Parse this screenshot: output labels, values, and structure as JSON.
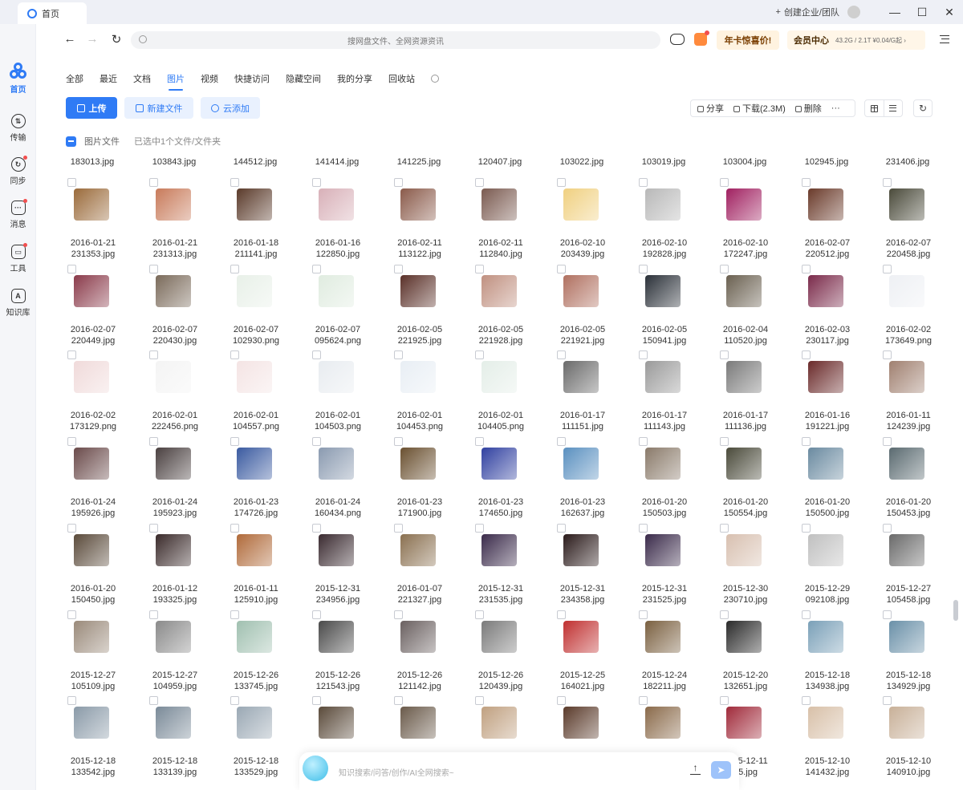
{
  "window": {
    "tab_title": "首页",
    "create_team": "创建企业/团队",
    "controls": [
      "—",
      "☐",
      "✕"
    ]
  },
  "rail": {
    "items": [
      {
        "label": "首页",
        "icon": "home-logo-icon",
        "active": true
      },
      {
        "label": "传输",
        "icon": "transfer-icon",
        "badge": false
      },
      {
        "label": "同步",
        "icon": "sync-icon",
        "badge": true
      },
      {
        "label": "消息",
        "icon": "message-icon",
        "badge": true
      },
      {
        "label": "工具",
        "icon": "tools-icon",
        "badge": true
      },
      {
        "label": "知识库",
        "icon": "knowledge-icon",
        "badge": false
      }
    ]
  },
  "navbar": {
    "search_placeholder": "搜网盘文件、全网资源资讯",
    "promo_label": "年卡惊喜价!",
    "vip_label": "会员中心",
    "vip_quota": "43.2G / 2.1T  ¥0.04/G起 ›"
  },
  "filter_tabs": [
    {
      "label": "全部",
      "active": false
    },
    {
      "label": "最近",
      "active": false
    },
    {
      "label": "文档",
      "active": false
    },
    {
      "label": "图片",
      "active": true
    },
    {
      "label": "视频",
      "active": false
    },
    {
      "label": "快捷访问",
      "active": false
    },
    {
      "label": "隐藏空间",
      "active": false
    },
    {
      "label": "我的分享",
      "active": false
    },
    {
      "label": "回收站",
      "active": false
    }
  ],
  "toolbar": {
    "upload": "上传",
    "new_folder": "新建文件",
    "cloud_add": "云添加",
    "share": "分享",
    "download": "下载(2.3M)",
    "delete": "删除",
    "more": "···",
    "refresh": "↻"
  },
  "selection": {
    "label": "图片文件",
    "count_text": "已选中1个文件/文件夹"
  },
  "top_row_names": [
    "183013.jpg",
    "103843.jpg",
    "144512.jpg",
    "141414.jpg",
    "141225.jpg",
    "120407.jpg",
    "103022.jpg",
    "103019.jpg",
    "103004.jpg",
    "102945.jpg",
    "231406.jpg"
  ],
  "files": [
    [
      {
        "d": "2016-01-21",
        "n": "231353.jpg",
        "c": "#9a6a3a"
      },
      {
        "d": "2016-01-21",
        "n": "231313.jpg",
        "c": "#c87a5a"
      },
      {
        "d": "2016-01-18",
        "n": "211141.jpg",
        "c": "#5a3a2a"
      },
      {
        "d": "2016-01-16",
        "n": "122850.jpg",
        "c": "#d8b0b8"
      },
      {
        "d": "2016-02-11",
        "n": "113122.jpg",
        "c": "#8a5a4a"
      },
      {
        "d": "2016-02-11",
        "n": "112840.jpg",
        "c": "#7a5a50"
      },
      {
        "d": "2016-02-10",
        "n": "203439.jpg",
        "c": "#f0d080"
      },
      {
        "d": "2016-02-10",
        "n": "192828.jpg",
        "c": "#b8b8b8"
      },
      {
        "d": "2016-02-10",
        "n": "172247.jpg",
        "c": "#a02060"
      },
      {
        "d": "2016-02-07",
        "n": "220512.jpg",
        "c": "#6a3a2a"
      },
      {
        "d": "2016-02-07",
        "n": "220458.jpg",
        "c": "#4a4a3a"
      }
    ],
    [
      {
        "d": "2016-02-07",
        "n": "220449.jpg",
        "c": "#8a3a4a"
      },
      {
        "d": "2016-02-07",
        "n": "220430.jpg",
        "c": "#7a6a5a"
      },
      {
        "d": "2016-02-07",
        "n": "102930.png",
        "c": "#e8f0e8"
      },
      {
        "d": "2016-02-07",
        "n": "095624.png",
        "c": "#e0ece0"
      },
      {
        "d": "2016-02-05",
        "n": "221925.jpg",
        "c": "#5a3028"
      },
      {
        "d": "2016-02-05",
        "n": "221928.jpg",
        "c": "#c09080"
      },
      {
        "d": "2016-02-05",
        "n": "221921.jpg",
        "c": "#b07060"
      },
      {
        "d": "2016-02-05",
        "n": "150941.jpg",
        "c": "#2a3038"
      },
      {
        "d": "2016-02-04",
        "n": "110520.jpg",
        "c": "#6a6050"
      },
      {
        "d": "2016-02-03",
        "n": "230117.jpg",
        "c": "#7a2a4a"
      },
      {
        "d": "2016-02-02",
        "n": "173649.png",
        "c": "#eef0f4"
      }
    ],
    [
      {
        "d": "2016-02-02",
        "n": "173129.png",
        "c": "#f0dada"
      },
      {
        "d": "2016-02-01",
        "n": "222456.png",
        "c": "#f4f4f4"
      },
      {
        "d": "2016-02-01",
        "n": "104557.png",
        "c": "#f4e4e4"
      },
      {
        "d": "2016-02-01",
        "n": "104503.png",
        "c": "#e8ecf0"
      },
      {
        "d": "2016-02-01",
        "n": "104453.png",
        "c": "#e8eef4"
      },
      {
        "d": "2016-02-01",
        "n": "104405.png",
        "c": "#e4eee8"
      },
      {
        "d": "2016-01-17",
        "n": "111151.jpg",
        "c": "#6a6a6a"
      },
      {
        "d": "2016-01-17",
        "n": "111143.jpg",
        "c": "#9a9a9a"
      },
      {
        "d": "2016-01-17",
        "n": "111136.jpg",
        "c": "#7a7a7a"
      },
      {
        "d": "2016-01-16",
        "n": "191221.jpg",
        "c": "#6a2a2a"
      },
      {
        "d": "2016-01-11",
        "n": "124239.jpg",
        "c": "#a08070"
      }
    ],
    [
      {
        "d": "2016-01-24",
        "n": "195926.jpg",
        "c": "#6a4a4a"
      },
      {
        "d": "2016-01-24",
        "n": "195923.jpg",
        "c": "#4a4040"
      },
      {
        "d": "2016-01-23",
        "n": "174726.jpg",
        "c": "#3a5aa0"
      },
      {
        "d": "2016-01-24",
        "n": "160434.png",
        "c": "#8a9ab0"
      },
      {
        "d": "2016-01-23",
        "n": "171900.jpg",
        "c": "#6a5030"
      },
      {
        "d": "2016-01-23",
        "n": "174650.jpg",
        "c": "#3040a0"
      },
      {
        "d": "2016-01-23",
        "n": "162637.jpg",
        "c": "#5a90c0"
      },
      {
        "d": "2016-01-20",
        "n": "150503.jpg",
        "c": "#8a7a6a"
      },
      {
        "d": "2016-01-20",
        "n": "150554.jpg",
        "c": "#4a4a3a"
      },
      {
        "d": "2016-01-20",
        "n": "150500.jpg",
        "c": "#6a8aa0"
      },
      {
        "d": "2016-01-20",
        "n": "150453.jpg",
        "c": "#5a6a70"
      }
    ],
    [
      {
        "d": "2016-01-20",
        "n": "150450.jpg",
        "c": "#5a4a3a"
      },
      {
        "d": "2016-01-12",
        "n": "193325.jpg",
        "c": "#3a2a2a"
      },
      {
        "d": "2016-01-11",
        "n": "125910.jpg",
        "c": "#b06a3a"
      },
      {
        "d": "2015-12-31",
        "n": "234956.jpg",
        "c": "#3a2a30"
      },
      {
        "d": "2016-01-07",
        "n": "221327.jpg",
        "c": "#8a7050"
      },
      {
        "d": "2015-12-31",
        "n": "231535.jpg",
        "c": "#3a2a4a"
      },
      {
        "d": "2015-12-31",
        "n": "234358.jpg",
        "c": "#2a1a1a"
      },
      {
        "d": "2015-12-31",
        "n": "231525.jpg",
        "c": "#3a2a4a"
      },
      {
        "d": "2015-12-30",
        "n": "230710.jpg",
        "c": "#d8c0b0"
      },
      {
        "d": "2015-12-29",
        "n": "092108.jpg",
        "c": "#c0c0c0"
      },
      {
        "d": "2015-12-27",
        "n": "105458.jpg",
        "c": "#6a6a6a"
      }
    ],
    [
      {
        "d": "2015-12-27",
        "n": "105109.jpg",
        "c": "#9a8a7a"
      },
      {
        "d": "2015-12-27",
        "n": "104959.jpg",
        "c": "#8a8a8a"
      },
      {
        "d": "2015-12-26",
        "n": "133745.jpg",
        "c": "#a0c0b0"
      },
      {
        "d": "2015-12-26",
        "n": "121543.jpg",
        "c": "#4a4a4a"
      },
      {
        "d": "2015-12-26",
        "n": "121142.jpg",
        "c": "#6a6060"
      },
      {
        "d": "2015-12-26",
        "n": "120439.jpg",
        "c": "#7a7a7a"
      },
      {
        "d": "2015-12-25",
        "n": "164021.jpg",
        "c": "#c03030"
      },
      {
        "d": "2015-12-24",
        "n": "182211.jpg",
        "c": "#7a6040"
      },
      {
        "d": "2015-12-20",
        "n": "132651.jpg",
        "c": "#2a2a2a"
      },
      {
        "d": "2015-12-18",
        "n": "134938.jpg",
        "c": "#7aa0b8"
      },
      {
        "d": "2015-12-18",
        "n": "134929.jpg",
        "c": "#6a90a8"
      }
    ],
    [
      {
        "d": "2015-12-18",
        "n": "133542.jpg",
        "c": "#8a9aa8"
      },
      {
        "d": "2015-12-18",
        "n": "133139.jpg",
        "c": "#7a8a98"
      },
      {
        "d": "2015-12-18",
        "n": "133529.jpg",
        "c": "#9aa8b4"
      },
      {
        "d": "",
        "n": "",
        "c": "#5a4a3a"
      },
      {
        "d": "",
        "n": "",
        "c": "#6a5a4a"
      },
      {
        "d": "",
        "n": "",
        "c": "#c0a080"
      },
      {
        "d": "",
        "n": "",
        "c": "#5a3a2a"
      },
      {
        "d": "",
        "n": "",
        "c": "#8a6a4a"
      },
      {
        "d": "2015-12-11",
        "n": "55.jpg",
        "c": "#a02a3a"
      },
      {
        "d": "2015-12-10",
        "n": "141432.jpg",
        "c": "#d8c0a8"
      },
      {
        "d": "2015-12-10",
        "n": "140910.jpg",
        "c": "#c8b098"
      }
    ]
  ],
  "ai_bar": {
    "placeholder": "知识搜索/问答/创作/AI全网搜索~"
  }
}
